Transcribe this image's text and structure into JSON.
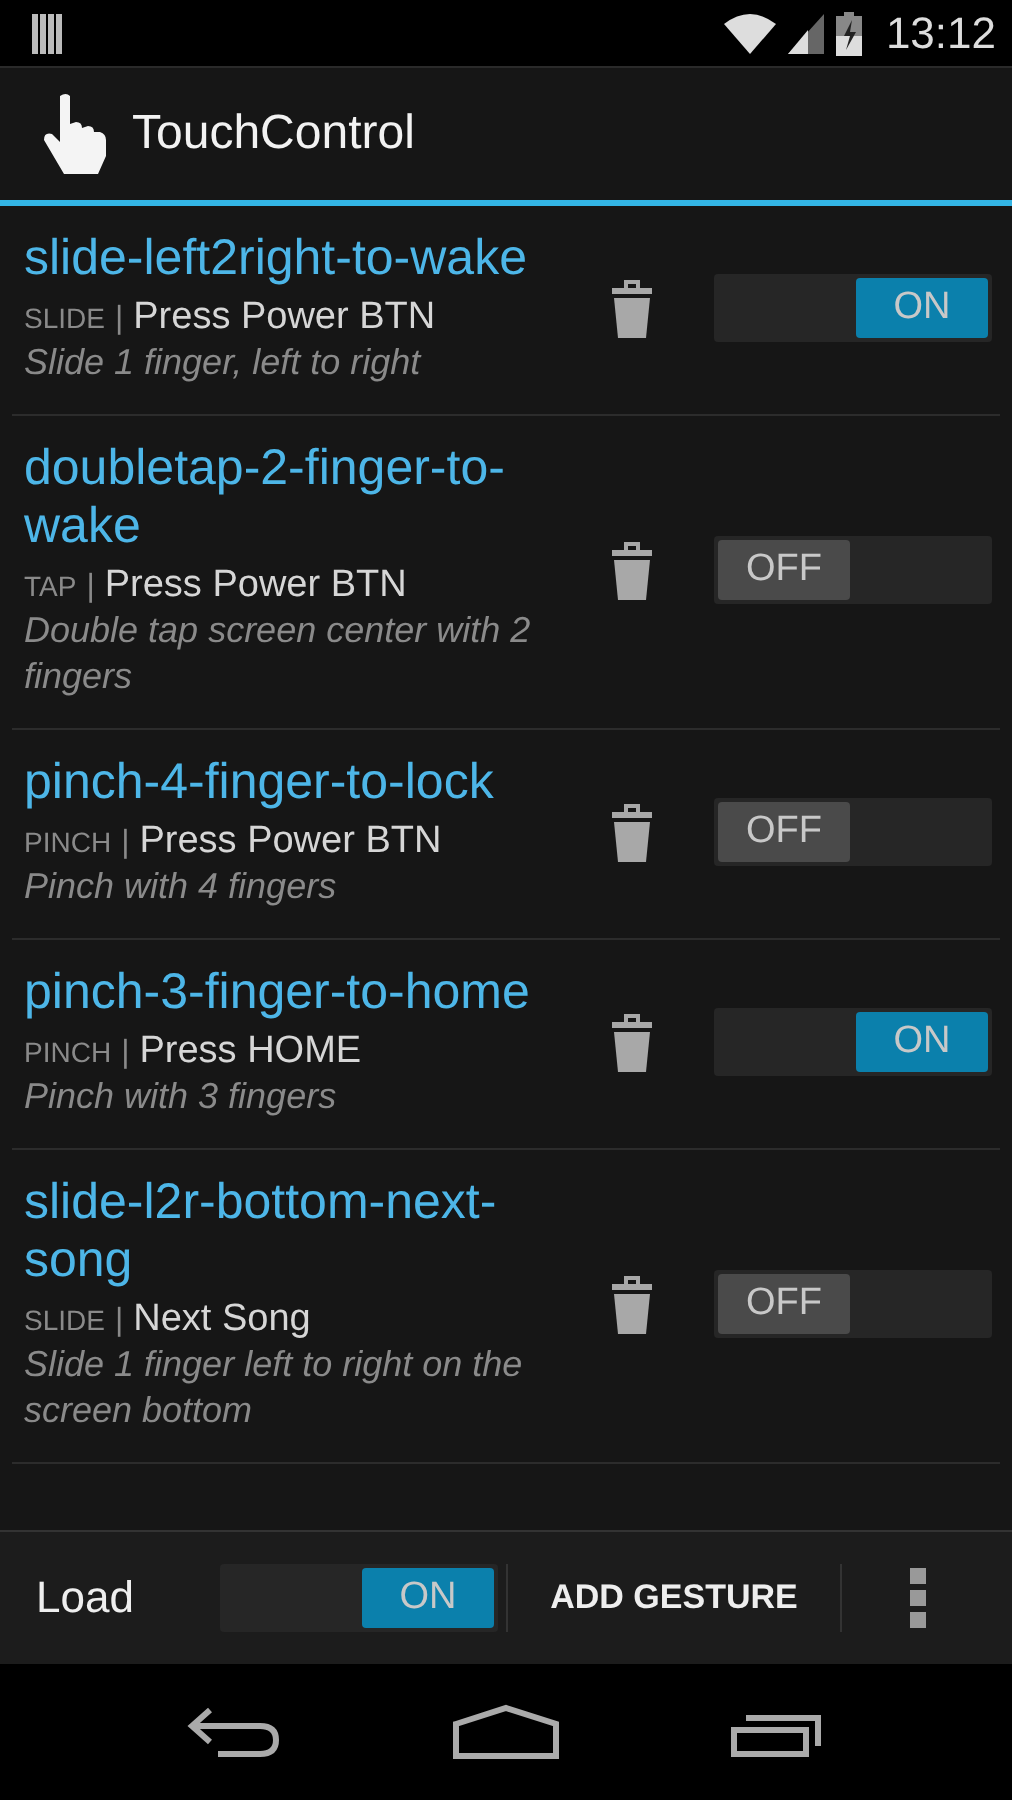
{
  "status_bar": {
    "time": "13:12"
  },
  "app_bar": {
    "title": "TouchControl"
  },
  "separator": "|",
  "gestures": [
    {
      "name": "slide-left2right-to-wake",
      "type": "SLIDE",
      "action": "Press Power BTN",
      "description": "Slide 1 finger, left to right",
      "on": true,
      "switch_text": "ON"
    },
    {
      "name": "doubletap-2-finger-to-wake",
      "type": "TAP",
      "action": "Press Power BTN",
      "description": "Double tap screen center with 2 fingers",
      "on": false,
      "switch_text": "OFF"
    },
    {
      "name": "pinch-4-finger-to-lock",
      "type": "PINCH",
      "action": "Press Power BTN",
      "description": "Pinch with 4 fingers",
      "on": false,
      "switch_text": "OFF"
    },
    {
      "name": "pinch-3-finger-to-home",
      "type": "PINCH",
      "action": "Press HOME",
      "description": "Pinch with 3 fingers",
      "on": true,
      "switch_text": "ON"
    },
    {
      "name": "slide-l2r-bottom-next-song",
      "type": "SLIDE",
      "action": "Next Song",
      "description": "Slide 1 finger left to right on the screen bottom",
      "on": false,
      "switch_text": "OFF"
    }
  ],
  "bottom_bar": {
    "label": "Load",
    "switch_on": true,
    "switch_text": "ON",
    "button": "ADD GESTURE"
  }
}
